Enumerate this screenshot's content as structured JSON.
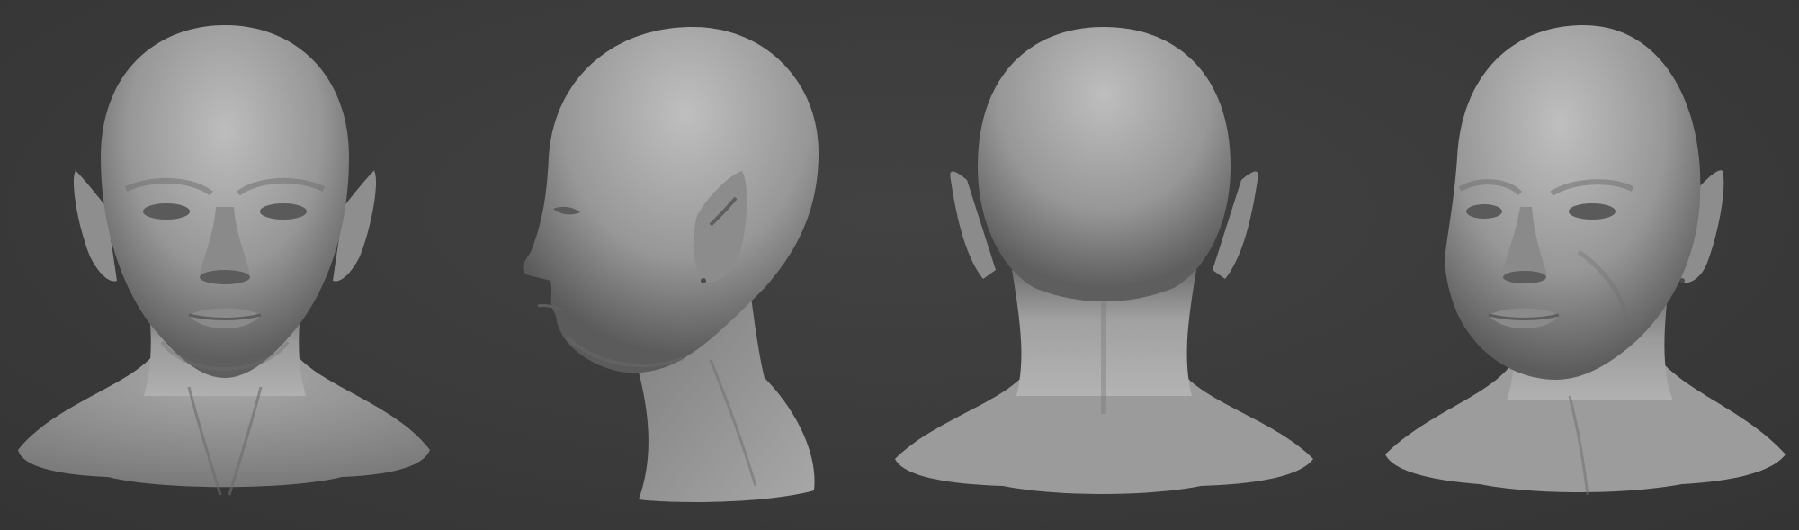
{
  "scene": {
    "background_color": "#3b3b3b",
    "material_color": "#8f8f8f",
    "highlight_color": "#c4c4c4",
    "shadow_color": "#4a4a4a",
    "views": [
      {
        "id": "front",
        "icon": "head-front-view"
      },
      {
        "id": "side",
        "icon": "head-profile-view"
      },
      {
        "id": "back",
        "icon": "head-back-view"
      },
      {
        "id": "three-quarter",
        "icon": "head-three-quarter-view"
      }
    ]
  }
}
